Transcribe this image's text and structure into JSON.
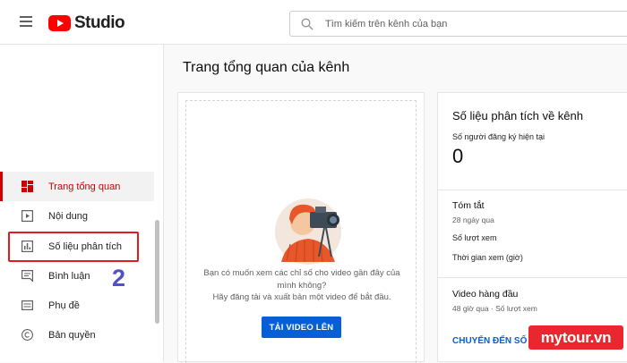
{
  "app": {
    "logo_text": "Studio",
    "logo_icon": "youtube-play-icon"
  },
  "search": {
    "placeholder": "Tìm kiếm trên kênh của bạn"
  },
  "sidebar": {
    "items": [
      {
        "label": "Trang tổng quan",
        "icon": "dashboard-icon",
        "active": true
      },
      {
        "label": "Nội dung",
        "icon": "content-icon"
      },
      {
        "label": "Số liệu phân tích",
        "icon": "analytics-icon"
      },
      {
        "label": "Bình luận",
        "icon": "comments-icon"
      },
      {
        "label": "Phụ đề",
        "icon": "subtitles-icon"
      },
      {
        "label": "Bản quyền",
        "icon": "copyright-icon"
      }
    ],
    "annotation_step": "2"
  },
  "main": {
    "title": "Trang tổng quan của kênh",
    "upload_card": {
      "prompt_line1": "Bạn có muốn xem các chỉ số cho video gần đây của mình không?",
      "prompt_line2": "Hãy đăng tải và xuất bản một video để bắt đầu.",
      "button_label": "TẢI VIDEO LÊN"
    },
    "analytics_card": {
      "title": "Số liệu phân tích về kênh",
      "subscribers_label": "Số người đăng ký hiện tại",
      "subscribers_value": "0",
      "summary_title": "Tóm tắt",
      "summary_period": "28 ngày qua",
      "views_label": "Số lượt xem",
      "watch_time_label": "Thời gian xem (giờ)",
      "top_videos_title": "Video hàng đầu",
      "top_videos_sub": "48 giờ qua · Số lượt xem",
      "link_label": "CHUYỂN ĐẾN SỐ LI"
    }
  },
  "watermark": {
    "text": "mytour.vn"
  },
  "colors": {
    "accent_red": "#cc0000",
    "brand_red": "#ff0000",
    "button_blue": "#065fd4",
    "annotation_red": "#e01b22",
    "annotation_number": "#5050c8"
  }
}
